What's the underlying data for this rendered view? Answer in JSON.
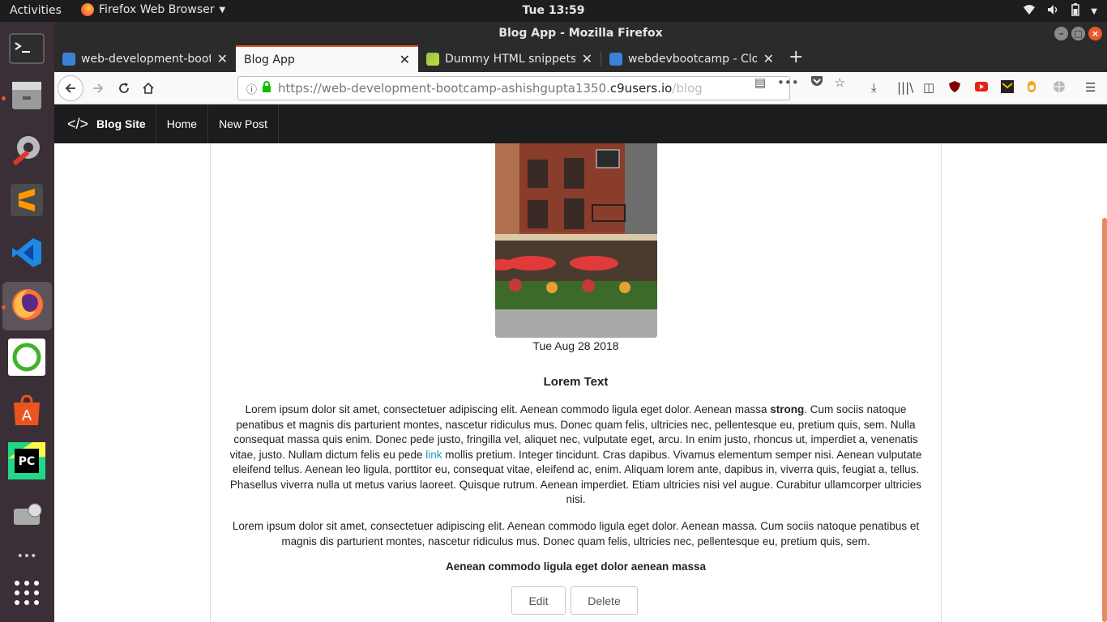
{
  "topbar": {
    "activities": "Activities",
    "app_menu": "Firefox Web Browser",
    "clock": "Tue 13:59"
  },
  "window": {
    "title": "Blog App - Mozilla Firefox"
  },
  "tabs": [
    {
      "label": "web-development-boot",
      "selected": false
    },
    {
      "label": "Blog App",
      "selected": true
    },
    {
      "label": "Dummy HTML snippets f",
      "selected": false
    },
    {
      "label": "webdevbootcamp - Clou",
      "selected": false
    }
  ],
  "url": {
    "prefix": "https://web-development-bootcamp-ashishgupta1350.",
    "host": "c9users.io",
    "path": "/blog"
  },
  "site": {
    "brand": "Blog Site",
    "nav": [
      "Home",
      "New Post"
    ]
  },
  "post": {
    "date": "Tue Aug 28 2018",
    "title": "Lorem Text",
    "para1_a": "Lorem ipsum dolor sit amet, consectetuer adipiscing elit. Aenean commodo ligula eget dolor. Aenean massa ",
    "para1_strong": "strong",
    "para1_b": ". Cum sociis natoque penatibus et magnis dis parturient montes, nascetur ridiculus mus. Donec quam felis, ultricies nec, pellentesque eu, pretium quis, sem. Nulla consequat massa quis enim. Donec pede justo, fringilla vel, aliquet nec, vulputate eget, arcu. In enim justo, rhoncus ut, imperdiet a, venenatis vitae, justo. Nullam dictum felis eu pede ",
    "para1_link": "link",
    "para1_c": " mollis pretium. Integer tincidunt. Cras dapibus. Vivamus elementum semper nisi. Aenean vulputate eleifend tellus. Aenean leo ligula, porttitor eu, consequat vitae, eleifend ac, enim. Aliquam lorem ante, dapibus in, viverra quis, feugiat a, tellus. Phasellus viverra nulla ut metus varius laoreet. Quisque rutrum. Aenean imperdiet. Etiam ultricies nisi vel augue. Curabitur ullamcorper ultricies nisi.",
    "para2": "Lorem ipsum dolor sit amet, consectetuer adipiscing elit. Aenean commodo ligula eget dolor. Aenean massa. Cum sociis natoque penatibus et magnis dis parturient montes, nascetur ridiculus mus. Donec quam felis, ultricies nec, pellentesque eu, pretium quis, sem.",
    "subhead": "Aenean commodo ligula eget dolor aenean massa",
    "edit_label": "Edit",
    "delete_label": "Delete"
  },
  "colors": {
    "accent": "#e9592c",
    "site_nav": "#1b1c1d",
    "link": "#1a9bc1"
  }
}
